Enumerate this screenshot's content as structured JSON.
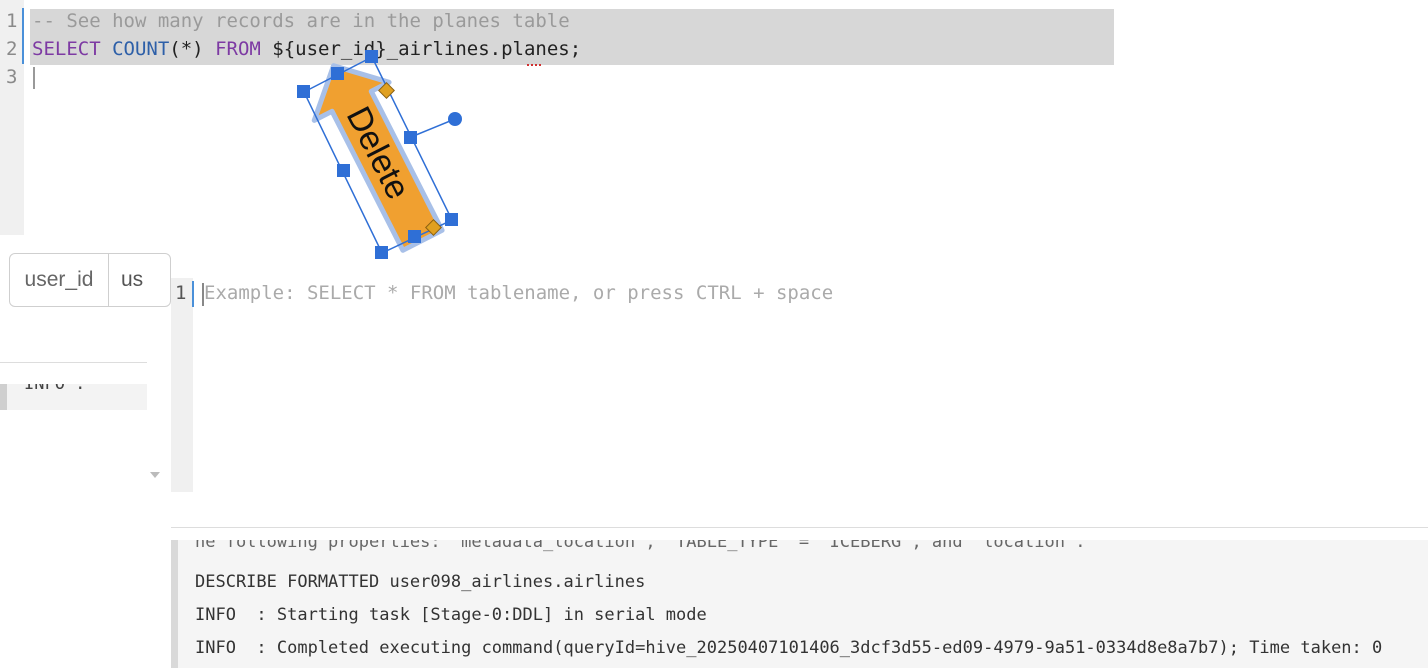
{
  "editor_top": {
    "line_numbers": [
      "1",
      "2",
      "3"
    ],
    "line1": "-- See how many records are in the planes table",
    "line2_parts": {
      "kw1": "SELECT",
      "fn": "COUNT",
      "args": "(*)",
      "kw2": "FROM",
      "rest": "${user_id}_airlines.planes;"
    }
  },
  "parameter": {
    "label": "user_id",
    "value": "us"
  },
  "log_left": {
    "text": "INFO  :"
  },
  "editor2": {
    "line_number": "1",
    "placeholder": "Example: SELECT * FROM tablename, or press CTRL + space"
  },
  "log_bottom": {
    "lines": [
      "he following properties: 'metadata_location', 'TABLE_TYPE' = 'ICEBERG', and 'location'.",
      "DESCRIBE FORMATTED user098_airlines.airlines",
      "INFO  : Starting task [Stage-0:DDL] in serial mode",
      "INFO  : Completed executing command(queryId=hive_20250407101406_3dcf3d55-ed09-4979-9a51-0334d8e8a7b7); Time taken: 0"
    ]
  },
  "annotation": {
    "label": "Delete",
    "colors": {
      "fill": "#f0a030",
      "outline": "#a8c0e8",
      "handle": "#2f6fd6",
      "corner": "#e0a020"
    }
  }
}
